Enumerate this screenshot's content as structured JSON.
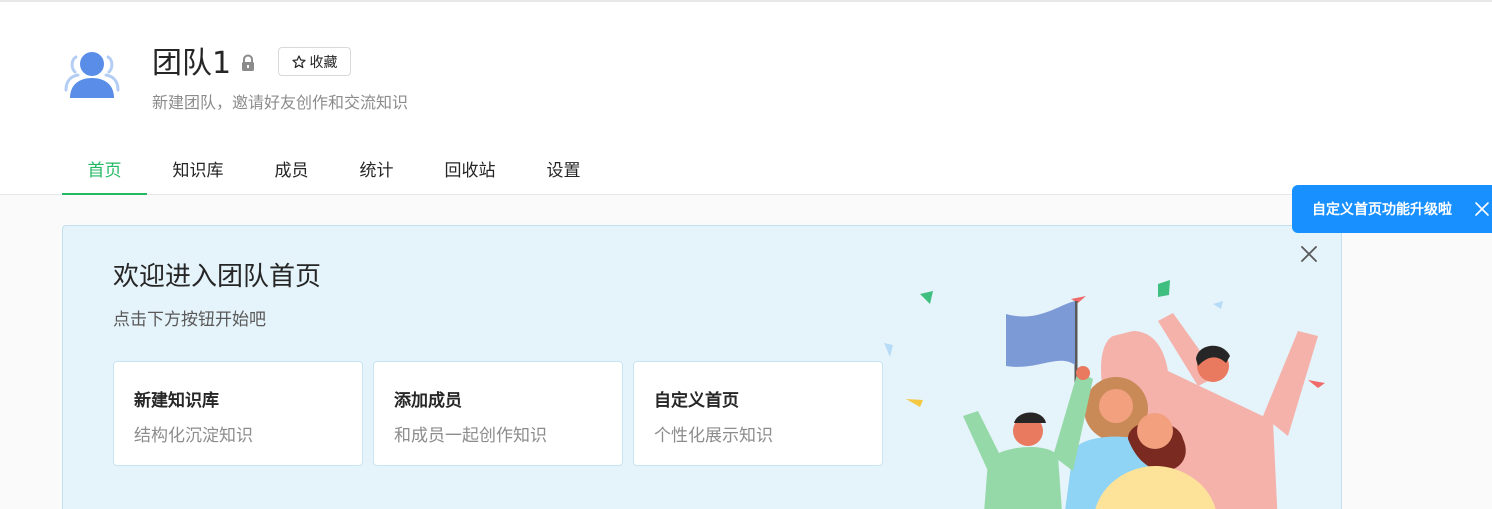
{
  "header": {
    "team_name": "团队1",
    "favorite_label": "收藏",
    "description": "新建团队，邀请好友创作和交流知识"
  },
  "tabs": [
    {
      "label": "首页",
      "active": true
    },
    {
      "label": "知识库",
      "active": false
    },
    {
      "label": "成员",
      "active": false
    },
    {
      "label": "统计",
      "active": false
    },
    {
      "label": "回收站",
      "active": false
    },
    {
      "label": "设置",
      "active": false
    }
  ],
  "welcome": {
    "title": "欢迎进入团队首页",
    "subtitle": "点击下方按钮开始吧",
    "cards": [
      {
        "title": "新建知识库",
        "desc": "结构化沉淀知识"
      },
      {
        "title": "添加成员",
        "desc": "和成员一起创作知识"
      },
      {
        "title": "自定义首页",
        "desc": "个性化展示知识"
      }
    ]
  },
  "toast": {
    "text": "自定义首页功能升级啦"
  },
  "colors": {
    "accent": "#25b864",
    "toast_bg": "#1890ff",
    "banner_bg": "#e5f3fa"
  },
  "icons": [
    "team-avatar-icon",
    "lock-icon",
    "star-icon",
    "close-icon"
  ]
}
